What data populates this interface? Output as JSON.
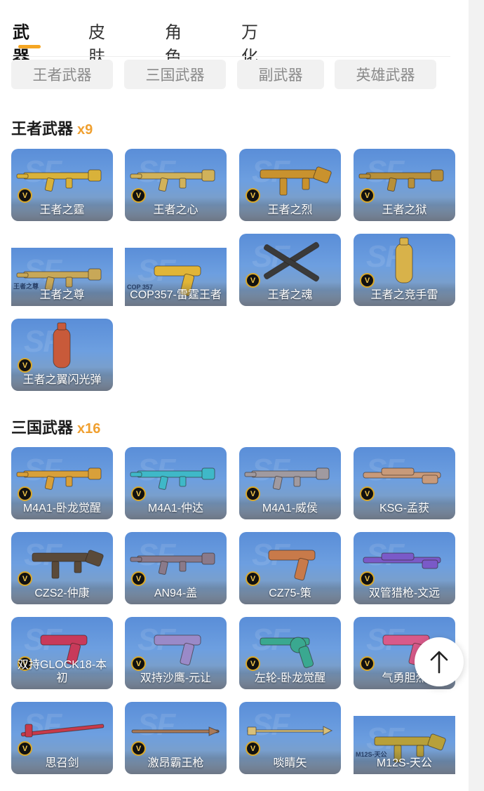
{
  "tabs": [
    {
      "label": "武器",
      "active": true
    },
    {
      "label": "皮肤",
      "active": false
    },
    {
      "label": "角色",
      "active": false
    },
    {
      "label": "万化",
      "active": false
    }
  ],
  "filters": [
    "王者武器",
    "三国武器",
    "副武器",
    "英雄武器"
  ],
  "sections": [
    {
      "title": "王者武器",
      "count": "x9",
      "items": [
        {
          "name": "王者之霆",
          "color": "#d9b23a",
          "icon": "rifle-icon"
        },
        {
          "name": "王者之心",
          "color": "#d1b25a",
          "icon": "rifle-icon"
        },
        {
          "name": "王者之烈",
          "color": "#c9922e",
          "icon": "smg-icon"
        },
        {
          "name": "王者之狱",
          "color": "#b8903a",
          "icon": "rifle-icon"
        },
        {
          "name": "王者之尊",
          "color": "#c8a858",
          "icon": "rifle-icon"
        },
        {
          "name": "COP357-雷霆王者",
          "color": "#e1b537",
          "icon": "pistol-icon"
        },
        {
          "name": "王者之魂",
          "color": "#3a3a3a",
          "icon": "blade-icon"
        },
        {
          "name": "王者之竞手雷",
          "color": "#d8b24a",
          "icon": "grenade-icon"
        },
        {
          "name": "王者之翼闪光弹",
          "color": "#c85a3a",
          "icon": "grenade-icon"
        }
      ]
    },
    {
      "title": "三国武器",
      "count": "x16",
      "items": [
        {
          "name": "M4A1-卧龙觉醒",
          "color": "#d8a03a",
          "icon": "rifle-icon"
        },
        {
          "name": "M4A1-仲达",
          "color": "#3fb8c8",
          "icon": "rifle-icon"
        },
        {
          "name": "M4A1-威侯",
          "color": "#a09aa0",
          "icon": "rifle-icon"
        },
        {
          "name": "KSG-孟获",
          "color": "#c89a7a",
          "icon": "shotgun-icon"
        },
        {
          "name": "CZS2-仲康",
          "color": "#5a4a3a",
          "icon": "smg-icon"
        },
        {
          "name": "AN94-盖",
          "color": "#8a7a8a",
          "icon": "rifle-icon"
        },
        {
          "name": "CZ75-策",
          "color": "#c87a4a",
          "icon": "pistol-icon"
        },
        {
          "name": "双管猎枪-文远",
          "color": "#7a5ac8",
          "icon": "shotgun-icon"
        },
        {
          "name": "双持GLOCK18-本初",
          "color": "#c83a5a",
          "icon": "pistol-icon"
        },
        {
          "name": "双持沙鹰-元让",
          "color": "#9a8ac8",
          "icon": "pistol-icon"
        },
        {
          "name": "左轮-卧龙觉醒",
          "color": "#3aa890",
          "icon": "revolver-icon"
        },
        {
          "name": "气勇胆烈",
          "color": "#d85a8a",
          "icon": "pistol-icon"
        },
        {
          "name": "思召剑",
          "color": "#c83a4a",
          "icon": "sword-icon"
        },
        {
          "name": "激昂霸王枪",
          "color": "#a87a5a",
          "icon": "spear-icon"
        },
        {
          "name": "啖睛矢",
          "color": "#d8c07a",
          "icon": "arrow-icon"
        },
        {
          "name": "M12S-天公",
          "color": "#b8a03a",
          "icon": "smg-icon"
        }
      ]
    }
  ],
  "badges": {
    "vip": "V",
    "stamp_1": "王者之尊",
    "stamp_2": "COP 357",
    "stamp_3": "M12S-天公"
  },
  "colors": {
    "accent": "#f5a623",
    "count": "#f0a030"
  }
}
